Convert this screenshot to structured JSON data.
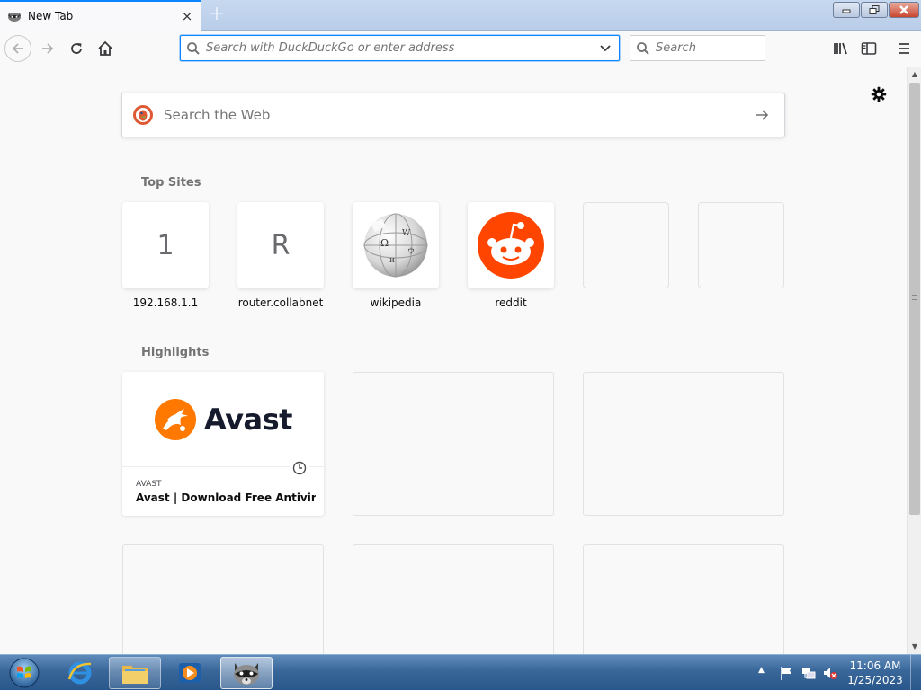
{
  "window": {
    "tab_title": "New Tab",
    "close_tab": "×",
    "new_tab": "+"
  },
  "window_controls": {
    "minimize": "▭",
    "restore": "❐",
    "close": "✕"
  },
  "toolbar": {
    "url_placeholder": "Search with DuckDuckGo or enter address",
    "search_placeholder": "Search"
  },
  "newtab": {
    "websearch_placeholder": "Search the Web",
    "topsites_title": "Top Sites",
    "highlights_title": "Highlights",
    "topsites": [
      {
        "label": "192.168.1.1",
        "letter": "1"
      },
      {
        "label": "router.collabnet",
        "letter": "R"
      },
      {
        "label": "wikipedia",
        "icon": "wikipedia-globe-icon"
      },
      {
        "label": "reddit",
        "icon": "reddit-alien-icon"
      },
      {
        "label": ""
      },
      {
        "label": ""
      }
    ],
    "highlights": [
      {
        "brand": "Avast",
        "source": "AVAST",
        "title": "Avast | Download Free Antivirus ...",
        "icon": "clock-icon"
      }
    ]
  },
  "taskbar": {
    "clock_time": "11:06 AM",
    "clock_date": "1/25/2023",
    "tray_up": "▲",
    "apps": [
      "internet-explorer-icon",
      "file-explorer-icon",
      "media-player-icon",
      "firefox-raccoon-icon"
    ]
  },
  "scrollbar": {
    "up": "▲",
    "down": "▼"
  },
  "colors": {
    "accent": "#0a84ff",
    "reddit": "#ff4500",
    "avast": "#ff7800",
    "taskbar": "#3a679a"
  }
}
